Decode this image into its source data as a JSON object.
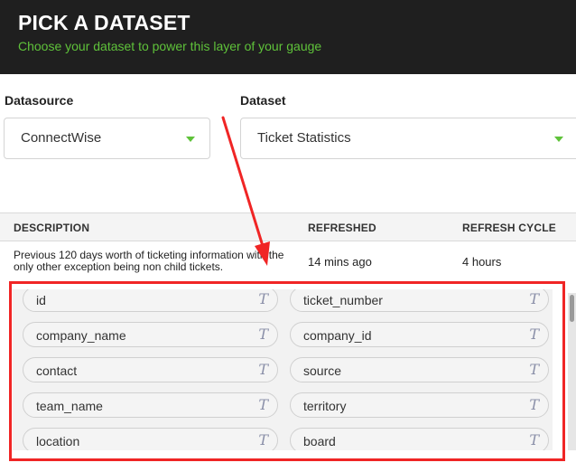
{
  "header": {
    "title": "PICK A DATASET",
    "subtitle": "Choose your dataset to power this layer of your gauge"
  },
  "datasource": {
    "label": "Datasource",
    "value": "ConnectWise"
  },
  "dataset": {
    "label": "Dataset",
    "value": "Ticket Statistics"
  },
  "table": {
    "columns": [
      "DESCRIPTION",
      "REFRESHED",
      "REFRESH CYCLE"
    ],
    "row": {
      "description": "Previous 120 days worth of ticketing information with the only other exception being non child tickets.",
      "refreshed": "14 mins ago",
      "refresh_cycle": "4 hours"
    }
  },
  "fields": [
    {
      "name": "id",
      "type": "T"
    },
    {
      "name": "ticket_number",
      "type": "T"
    },
    {
      "name": "company_name",
      "type": "T"
    },
    {
      "name": "company_id",
      "type": "T"
    },
    {
      "name": "contact",
      "type": "T"
    },
    {
      "name": "source",
      "type": "T"
    },
    {
      "name": "team_name",
      "type": "T"
    },
    {
      "name": "territory",
      "type": "T"
    },
    {
      "name": "location",
      "type": "T"
    },
    {
      "name": "board",
      "type": "T"
    }
  ],
  "colors": {
    "header_bg": "#1f1f1f",
    "accent_green": "#5fc23a",
    "annotation_red": "#f02525"
  },
  "icons": {
    "select_caret": "chevron-down-icon",
    "field_type": "text-type-icon"
  }
}
